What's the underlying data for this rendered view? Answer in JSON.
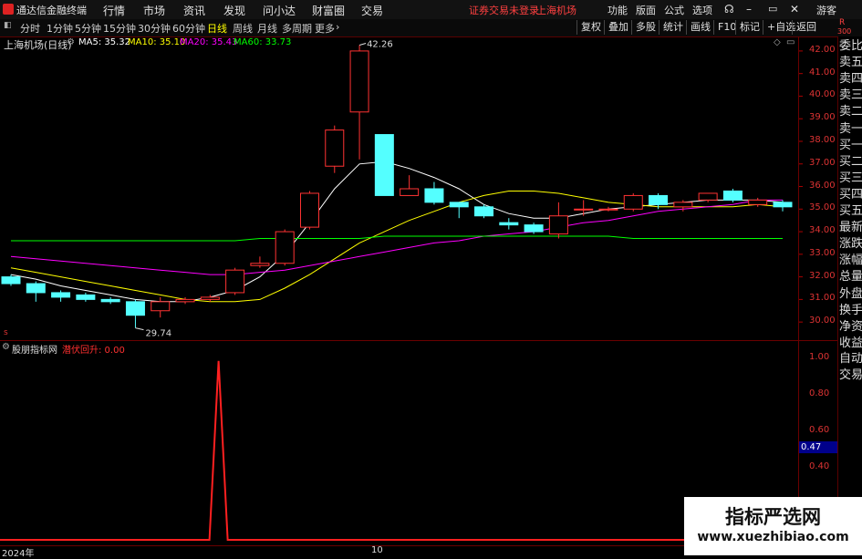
{
  "menubar": {
    "app_title": "通达信金融终端",
    "items": [
      "行情",
      "市场",
      "资讯",
      "发现",
      "问小达",
      "财富圈",
      "交易"
    ],
    "status_notice": "证券交易未登录",
    "stock_name": "上海机场",
    "right_items": [
      "功能",
      "版面",
      "公式",
      "选项"
    ],
    "user": "游客"
  },
  "toolbar": {
    "periods": [
      "分时",
      "1分钟",
      "5分钟",
      "15分钟",
      "30分钟",
      "60分钟",
      "日线",
      "周线",
      "月线",
      "多周期",
      "更多"
    ],
    "active_period": "日线",
    "tools": [
      "复权",
      "叠加",
      "多股",
      "统计",
      "画线",
      "F10",
      "标记",
      "+自选",
      "返回"
    ]
  },
  "chart": {
    "title": "上海机场(日线)",
    "ma": [
      {
        "label": "MA5: 35.32",
        "color": "#ffffff"
      },
      {
        "label": "MA10: 35.10",
        "color": "#ffff00"
      },
      {
        "label": "MA20: 35.43",
        "color": "#ff00ff"
      },
      {
        "label": "MA60: 33.73",
        "color": "#00ff00"
      }
    ],
    "high_label": "42.26",
    "low_label": "29.74",
    "y_ticks": [
      "42.00",
      "41.00",
      "40.00",
      "39.00",
      "38.00",
      "37.00",
      "36.00",
      "35.00",
      "34.00",
      "33.00",
      "32.00",
      "31.00",
      "30.00"
    ],
    "x_labels": [
      "2024年",
      "10"
    ]
  },
  "indicator": {
    "name": "股朋指标网",
    "series_label": "潜伏回升: 0.00",
    "y_ticks": [
      "1.00",
      "0.80",
      "0.60",
      "0.40"
    ],
    "current_value": "0.47"
  },
  "right_panel": {
    "top_label": "R",
    "top_value": "300",
    "items": [
      "委比",
      "卖五",
      "卖四",
      "卖三",
      "卖二",
      "卖一",
      "买一",
      "买二",
      "买三",
      "买四",
      "买五",
      "最新",
      "涨跌",
      "涨幅",
      "总量",
      "外盘",
      "换手",
      "净资",
      "收益"
    ],
    "bottom": [
      "自动",
      "交易"
    ]
  },
  "watermark": {
    "title": "指标严选网",
    "url": "www.xuezhibiao.com"
  },
  "colors": {
    "up": "#ff3333",
    "down": "#54ffff",
    "ma5": "#ffffff",
    "ma10": "#ffff00",
    "ma20": "#ff00ff",
    "ma60": "#00ff00",
    "signal": "#ff2020"
  },
  "chart_data": {
    "type": "candlestick",
    "y_range": [
      29.4,
      42.4
    ],
    "candles": [
      {
        "open": 32.0,
        "close": 31.7,
        "high": 32.1,
        "low": 31.6
      },
      {
        "open": 31.7,
        "close": 31.3,
        "high": 31.8,
        "low": 30.9
      },
      {
        "open": 31.3,
        "close": 31.1,
        "high": 31.4,
        "low": 30.9
      },
      {
        "open": 31.2,
        "close": 31.0,
        "high": 31.3,
        "low": 30.9
      },
      {
        "open": 31.0,
        "close": 30.9,
        "high": 31.1,
        "low": 30.8
      },
      {
        "open": 30.9,
        "close": 30.3,
        "high": 31.0,
        "low": 29.74
      },
      {
        "open": 30.5,
        "close": 30.9,
        "high": 31.1,
        "low": 30.2
      },
      {
        "open": 30.9,
        "close": 31.0,
        "high": 31.1,
        "low": 30.8
      },
      {
        "open": 31.0,
        "close": 31.1,
        "high": 31.2,
        "low": 30.9
      },
      {
        "open": 31.3,
        "close": 32.3,
        "high": 32.4,
        "low": 31.2
      },
      {
        "open": 32.5,
        "close": 32.6,
        "high": 32.9,
        "low": 32.4
      },
      {
        "open": 32.6,
        "close": 34.0,
        "high": 34.1,
        "low": 32.5
      },
      {
        "open": 34.2,
        "close": 35.7,
        "high": 35.8,
        "low": 34.1
      },
      {
        "open": 36.9,
        "close": 38.5,
        "high": 38.7,
        "low": 36.6
      },
      {
        "open": 39.3,
        "close": 42.0,
        "high": 42.26,
        "low": 37.2
      },
      {
        "open": 38.3,
        "close": 35.6,
        "high": 38.3,
        "low": 35.6
      },
      {
        "open": 35.6,
        "close": 35.9,
        "high": 36.5,
        "low": 35.6
      },
      {
        "open": 35.9,
        "close": 35.3,
        "high": 36.2,
        "low": 35.2
      },
      {
        "open": 35.3,
        "close": 35.1,
        "high": 35.3,
        "low": 34.6
      },
      {
        "open": 35.1,
        "close": 34.7,
        "high": 35.2,
        "low": 34.6
      },
      {
        "open": 34.4,
        "close": 34.3,
        "high": 34.6,
        "low": 34.1
      },
      {
        "open": 34.3,
        "close": 34.0,
        "high": 34.4,
        "low": 33.9
      },
      {
        "open": 33.9,
        "close": 34.7,
        "high": 35.3,
        "low": 33.7
      },
      {
        "open": 35.0,
        "close": 35.0,
        "high": 35.4,
        "low": 34.7
      },
      {
        "open": 35.0,
        "close": 35.0,
        "high": 35.1,
        "low": 34.9
      },
      {
        "open": 35.0,
        "close": 35.6,
        "high": 35.7,
        "low": 34.9
      },
      {
        "open": 35.6,
        "close": 35.2,
        "high": 35.7,
        "low": 35.0
      },
      {
        "open": 35.1,
        "close": 35.3,
        "high": 35.4,
        "low": 34.9
      },
      {
        "open": 35.4,
        "close": 35.7,
        "high": 35.7,
        "low": 35.3
      },
      {
        "open": 35.8,
        "close": 35.4,
        "high": 35.9,
        "low": 35.3
      },
      {
        "open": 35.2,
        "close": 35.4,
        "high": 35.5,
        "low": 35.1
      },
      {
        "open": 35.3,
        "close": 35.1,
        "high": 35.4,
        "low": 34.9
      }
    ],
    "series": [
      {
        "name": "MA5",
        "values": [
          32.1,
          31.9,
          31.6,
          31.4,
          31.2,
          31.0,
          30.9,
          30.9,
          31.1,
          31.4,
          32.0,
          33.0,
          34.4,
          35.9,
          37.0,
          37.1,
          36.8,
          36.4,
          35.9,
          35.2,
          34.8,
          34.6,
          34.6,
          34.8,
          35.0,
          35.1,
          35.2,
          35.3,
          35.4,
          35.4,
          35.4,
          35.3
        ]
      },
      {
        "name": "MA10",
        "values": [
          32.4,
          32.2,
          32.0,
          31.8,
          31.6,
          31.4,
          31.2,
          31.0,
          30.9,
          30.9,
          31.0,
          31.5,
          32.1,
          32.8,
          33.5,
          34.0,
          34.5,
          34.9,
          35.3,
          35.6,
          35.8,
          35.8,
          35.7,
          35.5,
          35.3,
          35.2,
          35.1,
          35.1,
          35.1,
          35.1,
          35.2,
          35.1
        ]
      },
      {
        "name": "MA20",
        "values": [
          32.9,
          32.8,
          32.7,
          32.6,
          32.5,
          32.4,
          32.3,
          32.2,
          32.1,
          32.1,
          32.2,
          32.3,
          32.5,
          32.7,
          32.9,
          33.1,
          33.3,
          33.5,
          33.6,
          33.8,
          33.9,
          34.0,
          34.2,
          34.4,
          34.5,
          34.7,
          34.9,
          35.0,
          35.1,
          35.2,
          35.4,
          35.4
        ]
      },
      {
        "name": "MA60",
        "values": [
          33.6,
          33.6,
          33.6,
          33.6,
          33.6,
          33.6,
          33.6,
          33.6,
          33.6,
          33.6,
          33.7,
          33.7,
          33.7,
          33.7,
          33.7,
          33.8,
          33.8,
          33.8,
          33.8,
          33.8,
          33.8,
          33.8,
          33.8,
          33.8,
          33.8,
          33.7,
          33.7,
          33.7,
          33.7,
          33.7,
          33.7,
          33.7
        ]
      }
    ],
    "indicator": {
      "name": "潜伏回升",
      "y_range": [
        0,
        1.05
      ],
      "values": [
        0,
        0,
        0,
        0,
        0,
        0,
        0,
        0,
        0,
        1,
        0,
        0,
        0,
        0,
        0,
        0,
        0,
        0,
        0,
        0,
        0,
        0,
        0,
        0,
        0,
        0,
        0,
        0,
        0,
        0,
        0,
        0
      ]
    }
  }
}
